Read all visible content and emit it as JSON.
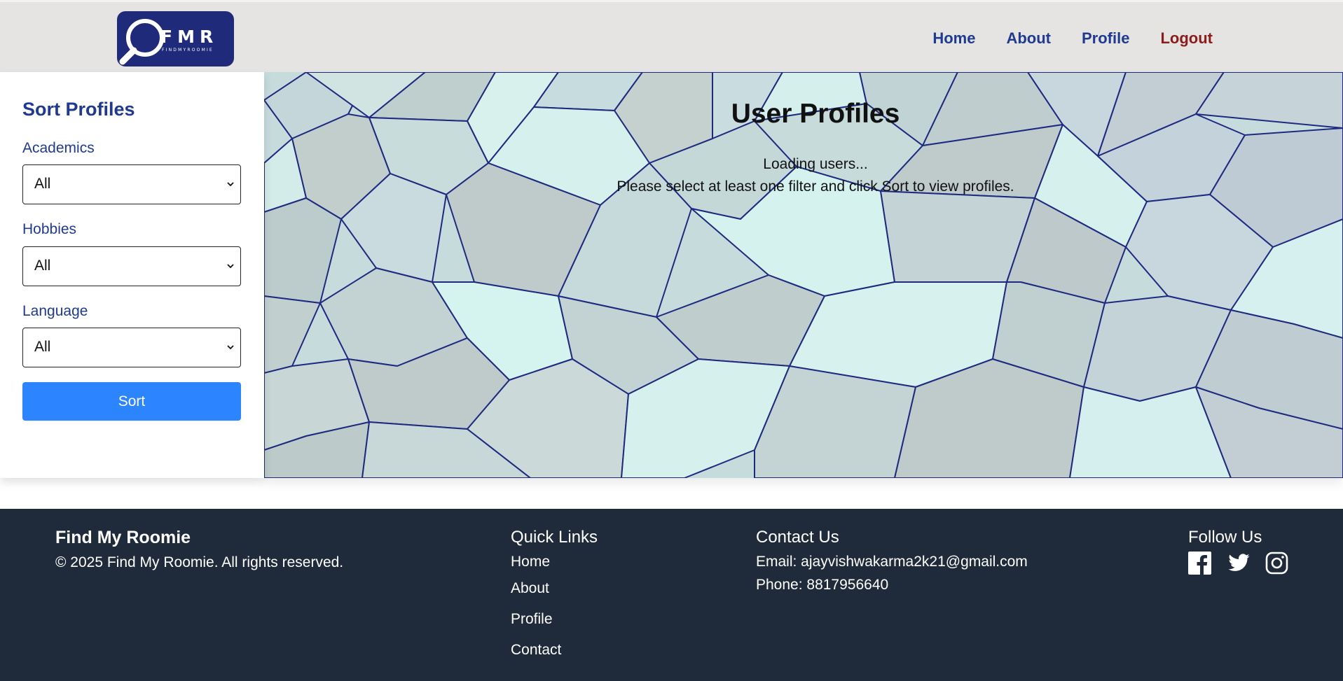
{
  "header": {
    "logo_text": "FMR",
    "logo_subtext": "FINDMYROOMIE",
    "nav": [
      {
        "label": "Home"
      },
      {
        "label": "About"
      },
      {
        "label": "Profile"
      },
      {
        "label": "Logout"
      }
    ]
  },
  "sidebar": {
    "title": "Sort Profiles",
    "filters": [
      {
        "label": "Academics",
        "value": "All"
      },
      {
        "label": "Hobbies",
        "value": "All"
      },
      {
        "label": "Language",
        "value": "All"
      }
    ],
    "sort_label": "Sort"
  },
  "main": {
    "title": "User Profiles",
    "loading_text": "Loading users...",
    "hint_text": "Please select at least one filter and click Sort to view profiles."
  },
  "footer": {
    "brand": "Find My Roomie",
    "copyright": "© 2025 Find My Roomie. All rights reserved.",
    "quick_links_title": "Quick Links",
    "quick_links": [
      "Home",
      "About",
      "Profile",
      "Contact"
    ],
    "contact_title": "Contact Us",
    "email": "Email: ajayvishwakarma2k21@gmail.com",
    "phone": "Phone: 8817956640",
    "follow_title": "Follow Us",
    "social_icons": [
      "facebook-icon",
      "twitter-icon",
      "instagram-icon"
    ]
  },
  "colors": {
    "nav_link": "#1f3a8f",
    "logout": "#8b1c1c",
    "sort_button": "#2d84ff",
    "footer_bg": "#1f2a3a",
    "header_bg": "#e5e4e3"
  }
}
